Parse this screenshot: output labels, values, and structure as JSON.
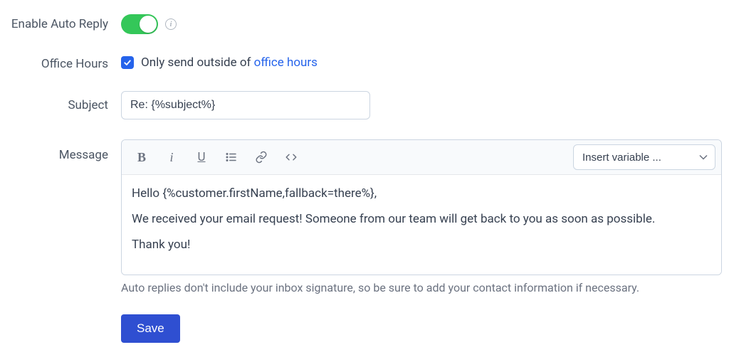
{
  "labels": {
    "enableAutoReply": "Enable Auto Reply",
    "officeHours": "Office Hours",
    "subject": "Subject",
    "message": "Message"
  },
  "officeHours": {
    "prefix": "Only send outside of ",
    "linkText": "office hours"
  },
  "subject": {
    "value": "Re: {%subject%}"
  },
  "editor": {
    "variablePlaceholder": "Insert variable ...",
    "body": {
      "line1": "Hello {%customer.firstName,fallback=there%},",
      "line2": "We received your email request! Someone from our team will get back to you as soon as possible.",
      "line3": "Thank you!"
    },
    "hint": "Auto replies don't include your inbox signature, so be sure to add your contact information if necessary."
  },
  "buttons": {
    "save": "Save"
  }
}
